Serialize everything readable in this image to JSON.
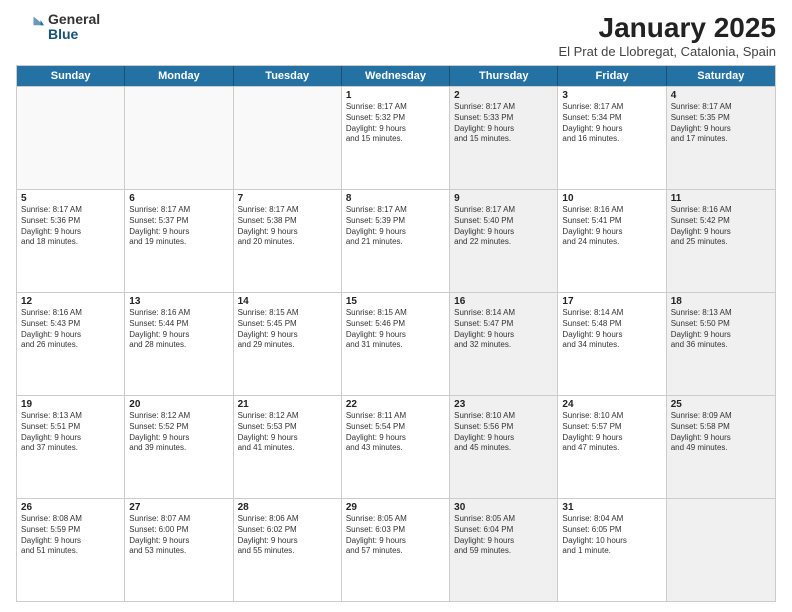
{
  "header": {
    "logo_general": "General",
    "logo_blue": "Blue",
    "month_title": "January 2025",
    "subtitle": "El Prat de Llobregat, Catalonia, Spain"
  },
  "weekdays": [
    "Sunday",
    "Monday",
    "Tuesday",
    "Wednesday",
    "Thursday",
    "Friday",
    "Saturday"
  ],
  "rows": [
    [
      {
        "day": "",
        "info": "",
        "shaded": false,
        "empty": true
      },
      {
        "day": "",
        "info": "",
        "shaded": false,
        "empty": true
      },
      {
        "day": "",
        "info": "",
        "shaded": false,
        "empty": true
      },
      {
        "day": "1",
        "info": "Sunrise: 8:17 AM\nSunset: 5:32 PM\nDaylight: 9 hours\nand 15 minutes.",
        "shaded": false,
        "empty": false
      },
      {
        "day": "2",
        "info": "Sunrise: 8:17 AM\nSunset: 5:33 PM\nDaylight: 9 hours\nand 15 minutes.",
        "shaded": true,
        "empty": false
      },
      {
        "day": "3",
        "info": "Sunrise: 8:17 AM\nSunset: 5:34 PM\nDaylight: 9 hours\nand 16 minutes.",
        "shaded": false,
        "empty": false
      },
      {
        "day": "4",
        "info": "Sunrise: 8:17 AM\nSunset: 5:35 PM\nDaylight: 9 hours\nand 17 minutes.",
        "shaded": true,
        "empty": false
      }
    ],
    [
      {
        "day": "5",
        "info": "Sunrise: 8:17 AM\nSunset: 5:36 PM\nDaylight: 9 hours\nand 18 minutes.",
        "shaded": false,
        "empty": false
      },
      {
        "day": "6",
        "info": "Sunrise: 8:17 AM\nSunset: 5:37 PM\nDaylight: 9 hours\nand 19 minutes.",
        "shaded": false,
        "empty": false
      },
      {
        "day": "7",
        "info": "Sunrise: 8:17 AM\nSunset: 5:38 PM\nDaylight: 9 hours\nand 20 minutes.",
        "shaded": false,
        "empty": false
      },
      {
        "day": "8",
        "info": "Sunrise: 8:17 AM\nSunset: 5:39 PM\nDaylight: 9 hours\nand 21 minutes.",
        "shaded": false,
        "empty": false
      },
      {
        "day": "9",
        "info": "Sunrise: 8:17 AM\nSunset: 5:40 PM\nDaylight: 9 hours\nand 22 minutes.",
        "shaded": true,
        "empty": false
      },
      {
        "day": "10",
        "info": "Sunrise: 8:16 AM\nSunset: 5:41 PM\nDaylight: 9 hours\nand 24 minutes.",
        "shaded": false,
        "empty": false
      },
      {
        "day": "11",
        "info": "Sunrise: 8:16 AM\nSunset: 5:42 PM\nDaylight: 9 hours\nand 25 minutes.",
        "shaded": true,
        "empty": false
      }
    ],
    [
      {
        "day": "12",
        "info": "Sunrise: 8:16 AM\nSunset: 5:43 PM\nDaylight: 9 hours\nand 26 minutes.",
        "shaded": false,
        "empty": false
      },
      {
        "day": "13",
        "info": "Sunrise: 8:16 AM\nSunset: 5:44 PM\nDaylight: 9 hours\nand 28 minutes.",
        "shaded": false,
        "empty": false
      },
      {
        "day": "14",
        "info": "Sunrise: 8:15 AM\nSunset: 5:45 PM\nDaylight: 9 hours\nand 29 minutes.",
        "shaded": false,
        "empty": false
      },
      {
        "day": "15",
        "info": "Sunrise: 8:15 AM\nSunset: 5:46 PM\nDaylight: 9 hours\nand 31 minutes.",
        "shaded": false,
        "empty": false
      },
      {
        "day": "16",
        "info": "Sunrise: 8:14 AM\nSunset: 5:47 PM\nDaylight: 9 hours\nand 32 minutes.",
        "shaded": true,
        "empty": false
      },
      {
        "day": "17",
        "info": "Sunrise: 8:14 AM\nSunset: 5:48 PM\nDaylight: 9 hours\nand 34 minutes.",
        "shaded": false,
        "empty": false
      },
      {
        "day": "18",
        "info": "Sunrise: 8:13 AM\nSunset: 5:50 PM\nDaylight: 9 hours\nand 36 minutes.",
        "shaded": true,
        "empty": false
      }
    ],
    [
      {
        "day": "19",
        "info": "Sunrise: 8:13 AM\nSunset: 5:51 PM\nDaylight: 9 hours\nand 37 minutes.",
        "shaded": false,
        "empty": false
      },
      {
        "day": "20",
        "info": "Sunrise: 8:12 AM\nSunset: 5:52 PM\nDaylight: 9 hours\nand 39 minutes.",
        "shaded": false,
        "empty": false
      },
      {
        "day": "21",
        "info": "Sunrise: 8:12 AM\nSunset: 5:53 PM\nDaylight: 9 hours\nand 41 minutes.",
        "shaded": false,
        "empty": false
      },
      {
        "day": "22",
        "info": "Sunrise: 8:11 AM\nSunset: 5:54 PM\nDaylight: 9 hours\nand 43 minutes.",
        "shaded": false,
        "empty": false
      },
      {
        "day": "23",
        "info": "Sunrise: 8:10 AM\nSunset: 5:56 PM\nDaylight: 9 hours\nand 45 minutes.",
        "shaded": true,
        "empty": false
      },
      {
        "day": "24",
        "info": "Sunrise: 8:10 AM\nSunset: 5:57 PM\nDaylight: 9 hours\nand 47 minutes.",
        "shaded": false,
        "empty": false
      },
      {
        "day": "25",
        "info": "Sunrise: 8:09 AM\nSunset: 5:58 PM\nDaylight: 9 hours\nand 49 minutes.",
        "shaded": true,
        "empty": false
      }
    ],
    [
      {
        "day": "26",
        "info": "Sunrise: 8:08 AM\nSunset: 5:59 PM\nDaylight: 9 hours\nand 51 minutes.",
        "shaded": false,
        "empty": false
      },
      {
        "day": "27",
        "info": "Sunrise: 8:07 AM\nSunset: 6:00 PM\nDaylight: 9 hours\nand 53 minutes.",
        "shaded": false,
        "empty": false
      },
      {
        "day": "28",
        "info": "Sunrise: 8:06 AM\nSunset: 6:02 PM\nDaylight: 9 hours\nand 55 minutes.",
        "shaded": false,
        "empty": false
      },
      {
        "day": "29",
        "info": "Sunrise: 8:05 AM\nSunset: 6:03 PM\nDaylight: 9 hours\nand 57 minutes.",
        "shaded": false,
        "empty": false
      },
      {
        "day": "30",
        "info": "Sunrise: 8:05 AM\nSunset: 6:04 PM\nDaylight: 9 hours\nand 59 minutes.",
        "shaded": true,
        "empty": false
      },
      {
        "day": "31",
        "info": "Sunrise: 8:04 AM\nSunset: 6:05 PM\nDaylight: 10 hours\nand 1 minute.",
        "shaded": false,
        "empty": false
      },
      {
        "day": "",
        "info": "",
        "shaded": true,
        "empty": true
      }
    ]
  ]
}
